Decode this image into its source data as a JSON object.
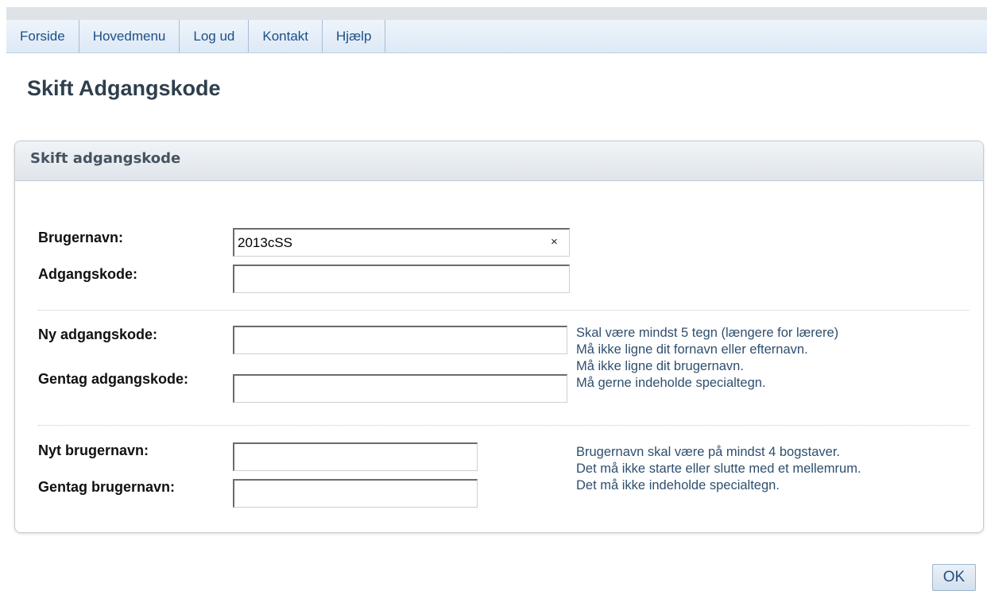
{
  "nav": {
    "items": [
      {
        "label": "Forside"
      },
      {
        "label": "Hovedmenu"
      },
      {
        "label": "Log ud"
      },
      {
        "label": "Kontakt"
      },
      {
        "label": "Hjælp"
      }
    ]
  },
  "page": {
    "title": "Skift Adgangskode"
  },
  "panel": {
    "title": "Skift adgangskode",
    "username_label": "Brugernavn:",
    "username_value": "2013cSS",
    "clear_glyph": "×",
    "password_label": "Adgangskode:",
    "password_value": "",
    "new_password_label": "Ny adgangskode:",
    "repeat_password_label": "Gentag adgangskode:",
    "password_hints": [
      "Skal være mindst 5 tegn (længere for lærere)",
      "Må ikke ligne dit fornavn eller efternavn.",
      "Må ikke ligne dit brugernavn.",
      "Må gerne indeholde specialtegn."
    ],
    "new_username_label": "Nyt brugernavn:",
    "repeat_username_label": "Gentag brugernavn:",
    "username_hints": [
      "Brugernavn skal være på mindst 4 bogstaver.",
      "Det må ikke starte eller slutte med et mellemrum.",
      "Det må ikke indeholde specialtegn."
    ]
  },
  "actions": {
    "ok_label": "OK"
  }
}
